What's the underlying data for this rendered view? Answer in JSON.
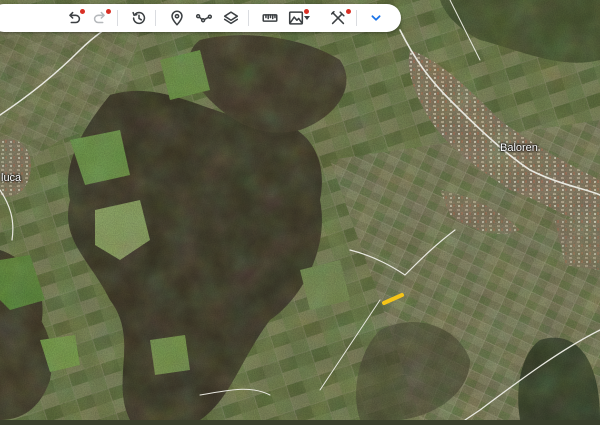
{
  "map": {
    "places": {
      "baloren": "Baloren",
      "luca": "luca"
    },
    "highlight_color": "#f5c518",
    "road_color": "#e8e8e0"
  },
  "toolbar": {
    "search_value": "",
    "tools": [
      {
        "name": "undo",
        "icon": "undo-icon",
        "badge": true,
        "enabled": true
      },
      {
        "name": "redo",
        "icon": "redo-icon",
        "badge": true,
        "enabled": false
      },
      {
        "name": "historical-imagery",
        "icon": "history-clock-icon",
        "badge": false,
        "enabled": true
      },
      {
        "name": "add-placemark",
        "icon": "placemark-pin-icon",
        "badge": false,
        "enabled": true
      },
      {
        "name": "draw-path",
        "icon": "path-icon",
        "badge": false,
        "enabled": true
      },
      {
        "name": "layers",
        "icon": "layers-icon",
        "badge": false,
        "enabled": true
      },
      {
        "name": "measure",
        "icon": "ruler-icon",
        "badge": false,
        "enabled": true
      },
      {
        "name": "elevation",
        "icon": "mountain-icon",
        "badge": true,
        "enabled": true
      },
      {
        "name": "tools",
        "icon": "tools-icon",
        "badge": true,
        "enabled": true
      },
      {
        "name": "expand",
        "icon": "chevron-down-icon",
        "badge": false,
        "enabled": true
      }
    ],
    "accent_color": "#1a73e8",
    "badge_color": "#d93025"
  }
}
